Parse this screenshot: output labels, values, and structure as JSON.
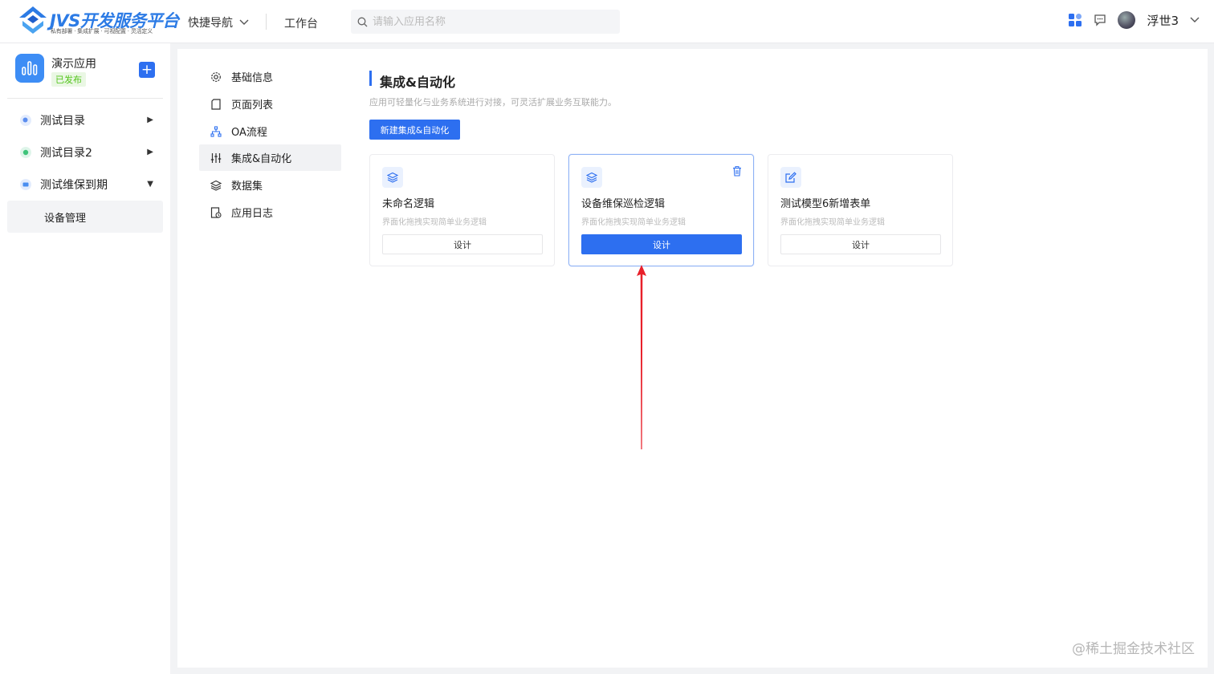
{
  "header": {
    "logo_title": "JVS开发服务平台",
    "logo_subtitle": "私有部署 · 集成扩展 · 可视配置 · 灵活定义",
    "quick_nav_label": "快捷导航",
    "workbench_label": "工作台",
    "search_placeholder": "请输入应用名称",
    "username": "浮世3",
    "icons": [
      "apps-grid-icon",
      "message-icon",
      "chevron-down-icon",
      "search-icon"
    ]
  },
  "sidebar": {
    "app_name": "演示应用",
    "app_status": "已发布",
    "add_label": "+",
    "items": [
      {
        "label": "测试目录",
        "dot_color": "#5b8def",
        "expanded": false
      },
      {
        "label": "测试目录2",
        "dot_color": "#3ec47a",
        "expanded": false
      },
      {
        "label": "测试维保到期",
        "dot_color": "#4a8ef0",
        "expanded": true
      }
    ],
    "sub_item": "设备管理"
  },
  "settings_menu": {
    "items": [
      {
        "label": "基础信息",
        "icon": "gear-icon"
      },
      {
        "label": "页面列表",
        "icon": "page-icon"
      },
      {
        "label": "OA流程",
        "icon": "flow-icon"
      },
      {
        "label": "集成&自动化",
        "icon": "sliders-icon",
        "active": true
      },
      {
        "label": "数据集",
        "icon": "layers-icon"
      },
      {
        "label": "应用日志",
        "icon": "log-icon"
      }
    ]
  },
  "main": {
    "title": "集成&自动化",
    "description": "应用可轻量化与业务系统进行对接，可灵活扩展业务互联能力。",
    "new_button": "新建集成&自动化",
    "cards": [
      {
        "title": "未命名逻辑",
        "desc": "界面化拖拽实现简单业务逻辑",
        "button": "设计",
        "icon": "layers-icon",
        "selected": false
      },
      {
        "title": "设备维保巡检逻辑",
        "desc": "界面化拖拽实现简单业务逻辑",
        "button": "设计",
        "icon": "layers-icon",
        "selected": true
      },
      {
        "title": "测试模型6新增表单",
        "desc": "界面化拖拽实现简单业务逻辑",
        "button": "设计",
        "icon": "edit-icon",
        "selected": false
      }
    ]
  },
  "watermark": "@稀土掘金技术社区",
  "colors": {
    "primary": "#2d6ff0",
    "annotation_arrow": "#e8202a",
    "published_green": "#52c41a"
  }
}
